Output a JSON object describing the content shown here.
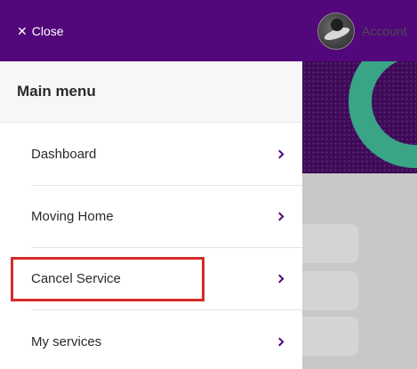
{
  "header": {
    "close_label": "Close",
    "account_label": "Account"
  },
  "menu": {
    "title": "Main menu",
    "items": [
      {
        "label": "Dashboard",
        "icon": "chevron-right-icon"
      },
      {
        "label": "Moving Home",
        "icon": "chevron-right-icon"
      },
      {
        "label": "Cancel Service",
        "icon": "chevron-right-icon",
        "highlighted": true
      },
      {
        "label": "My services",
        "icon": "chevron-right-icon"
      }
    ]
  },
  "colors": {
    "brand_purple": "#52077a",
    "accent_green": "#3aa487",
    "highlight_red": "#d62a2a"
  }
}
